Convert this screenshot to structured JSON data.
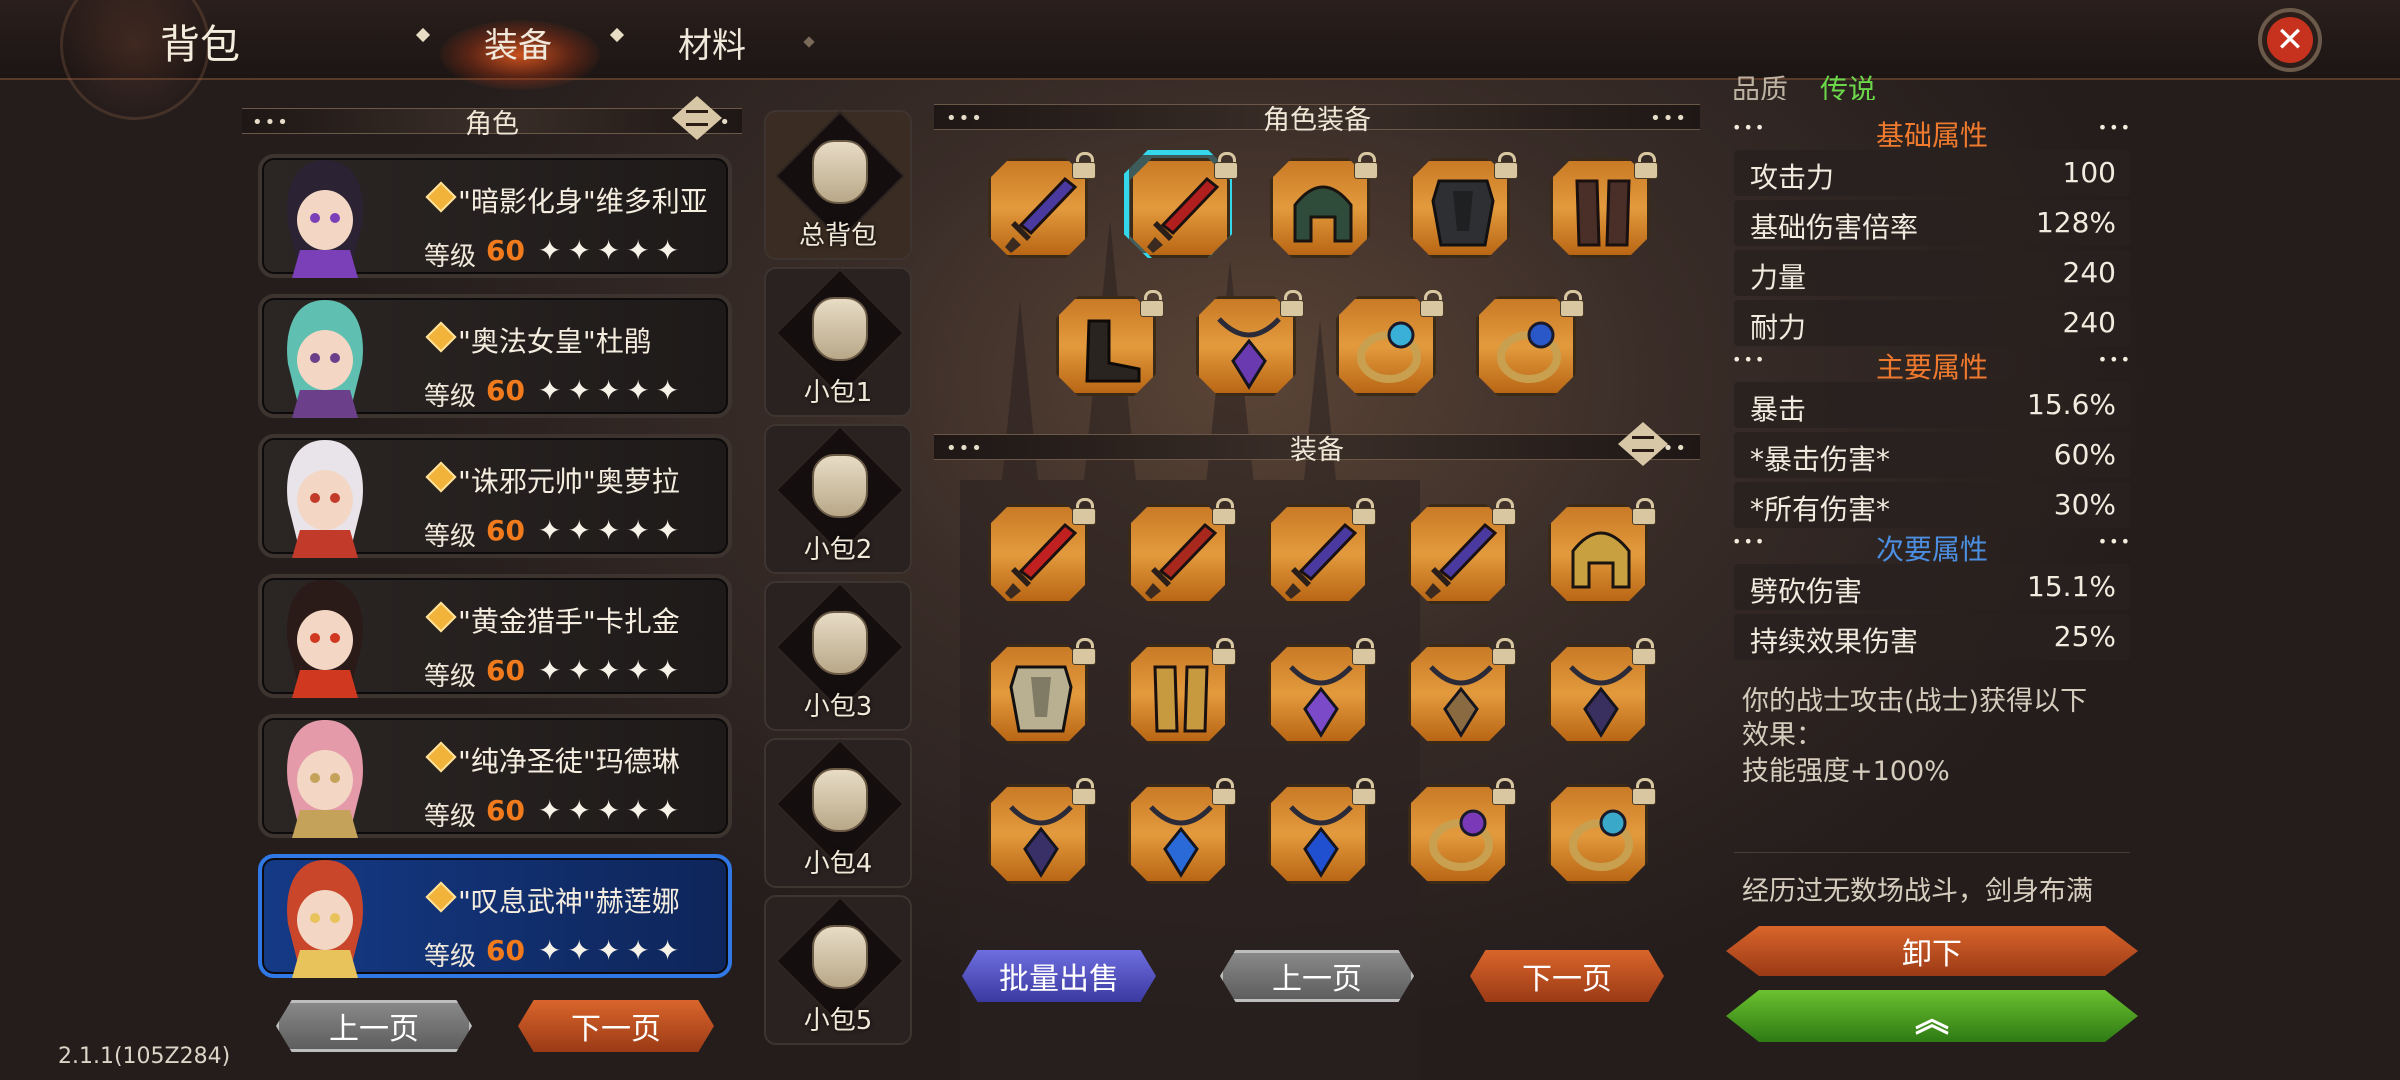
{
  "header": {
    "title": "背包",
    "tabs": [
      {
        "label": "装备",
        "active": true
      },
      {
        "label": "材料",
        "active": false
      }
    ]
  },
  "left": {
    "section_title": "角色",
    "characters": [
      {
        "name": "\"暗影化身\"维多利亚",
        "level_label": "等级",
        "level": "60",
        "stars": "✦✦✦✦✦",
        "selected": false,
        "hair": "#2b2233",
        "accent": "#7b3fb8"
      },
      {
        "name": "\"奥法女皇\"杜鹃",
        "level_label": "等级",
        "level": "60",
        "stars": "✦✦✦✦✦",
        "selected": false,
        "hair": "#5fbfb0",
        "accent": "#6b3f8a"
      },
      {
        "name": "\"诛邪元帅\"奥萝拉",
        "level_label": "等级",
        "level": "60",
        "stars": "✦✦✦✦✦",
        "selected": false,
        "hair": "#e8e4ea",
        "accent": "#c23a2a"
      },
      {
        "name": "\"黄金猎手\"卡扎金",
        "level_label": "等级",
        "level": "60",
        "stars": "✦✦✦✦✦",
        "selected": false,
        "hair": "#2a1a18",
        "accent": "#d03820"
      },
      {
        "name": "\"纯净圣徒\"玛德琳",
        "level_label": "等级",
        "level": "60",
        "stars": "✦✦✦✦✦",
        "selected": false,
        "hair": "#e49aa8",
        "accent": "#c4a25a"
      },
      {
        "name": "\"叹息武神\"赫莲娜",
        "level_label": "等级",
        "level": "60",
        "stars": "✦✦✦✦✦",
        "selected": true,
        "hair": "#c9462a",
        "accent": "#e8c25a"
      }
    ],
    "prev_page": "上一页",
    "next_page": "下一页"
  },
  "bags": [
    "总背包",
    "小包1",
    "小包2",
    "小包3",
    "小包4",
    "小包5"
  ],
  "equip_section": {
    "title": "角色装备",
    "items": [
      {
        "icon": "purple-sword-icon",
        "color": "#4a3aa0"
      },
      {
        "icon": "red-sword-icon",
        "color": "#b01e1e",
        "selected": true
      },
      {
        "icon": "green-hood-icon",
        "color": "#2f4b3a"
      },
      {
        "icon": "dark-armor-icon",
        "color": "#2d2f32"
      },
      {
        "icon": "leather-gloves-icon",
        "color": "#4a2e28"
      },
      {
        "icon": "dark-boots-icon",
        "color": "#2a2420"
      },
      {
        "icon": "purple-amulet-icon",
        "color": "#6a3ab0"
      },
      {
        "icon": "blue-ring-icon",
        "color": "#3ab0d8"
      },
      {
        "icon": "sapphire-ring-icon",
        "color": "#2a58c8"
      }
    ]
  },
  "inventory_section": {
    "title": "装备",
    "items": [
      {
        "icon": "crimson-sword-icon",
        "color": "#c02020"
      },
      {
        "icon": "red-blade-icon",
        "color": "#a8281e"
      },
      {
        "icon": "violet-sword-icon",
        "color": "#4a3aa0"
      },
      {
        "icon": "violet-sword-icon",
        "color": "#4a3aa0"
      },
      {
        "icon": "gold-helmet-icon",
        "color": "#c8a040"
      },
      {
        "icon": "bone-armor-icon",
        "color": "#b8b090"
      },
      {
        "icon": "gold-bracers-icon",
        "color": "#c89a40"
      },
      {
        "icon": "amethyst-necklace-icon",
        "color": "#7a4ac8"
      },
      {
        "icon": "bronze-necklace-icon",
        "color": "#8a6a40"
      },
      {
        "icon": "dark-necklace-icon",
        "color": "#3a3060"
      },
      {
        "icon": "dark-pendant-icon",
        "color": "#3a3068"
      },
      {
        "icon": "blue-pendant-icon",
        "color": "#2a6ad8"
      },
      {
        "icon": "blue-gem-icon",
        "color": "#2050d0"
      },
      {
        "icon": "violet-ring-icon",
        "color": "#7a3ab8"
      },
      {
        "icon": "cyan-ring-icon",
        "color": "#3aa8c8"
      }
    ]
  },
  "inventory_buttons": {
    "batch_sell": "批量出售",
    "prev_page": "上一页",
    "next_page": "下一页"
  },
  "detail": {
    "quality_label": "品质",
    "quality_value": "传说",
    "base_title": "基础属性",
    "base_stats": [
      {
        "k": "攻击力",
        "v": "100"
      },
      {
        "k": "基础伤害倍率",
        "v": "128%"
      },
      {
        "k": "力量",
        "v": "240"
      },
      {
        "k": "耐力",
        "v": "240"
      }
    ],
    "main_title": "主要属性",
    "main_stats": [
      {
        "k": "暴击",
        "v": "15.6%"
      },
      {
        "k": "*暴击伤害*",
        "v": "60%"
      },
      {
        "k": "*所有伤害*",
        "v": "30%"
      }
    ],
    "sub_title": "次要属性",
    "sub_stats": [
      {
        "k": "劈砍伤害",
        "v": "15.1%"
      },
      {
        "k": "持续效果伤害",
        "v": "25%"
      }
    ],
    "effect_line1": "你的战士攻击(战士)获得以下",
    "effect_line2": "效果：",
    "effect_line3": "技能强度+100%",
    "lore": "经历过无数场战斗，剑身布满",
    "unequip": "卸下",
    "upgrade_symbol": "︽"
  },
  "version": "2.1.1(105Z284)",
  "colors": {
    "accent_orange": "#f07a1c",
    "title_orange": "#ef7a2e",
    "select_cyan": "#35d8ea",
    "quality_green": "#6bd84a"
  }
}
